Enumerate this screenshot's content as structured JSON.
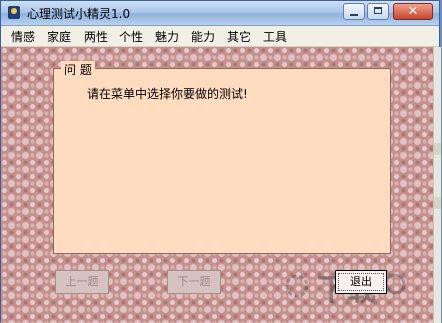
{
  "window": {
    "title": "心理测试小精灵1.0",
    "close_glyph": "✕"
  },
  "menu": {
    "items": [
      {
        "label": "情感"
      },
      {
        "label": "家庭"
      },
      {
        "label": "两性"
      },
      {
        "label": "个性"
      },
      {
        "label": "魅力"
      },
      {
        "label": "能力"
      },
      {
        "label": "其它"
      },
      {
        "label": "工具"
      }
    ]
  },
  "question_box": {
    "title": "问 题",
    "text": "请在菜单中选择你要做的测试!"
  },
  "buttons": {
    "prev_label": "上一题",
    "next_label": "下一题",
    "exit_label": "退出"
  },
  "watermark": {
    "text": "下载"
  },
  "colors": {
    "form_background": "#c4908e",
    "question_background": "#ffdcc0",
    "menubar": "#f1efe6",
    "close_button": "#c9432a"
  }
}
